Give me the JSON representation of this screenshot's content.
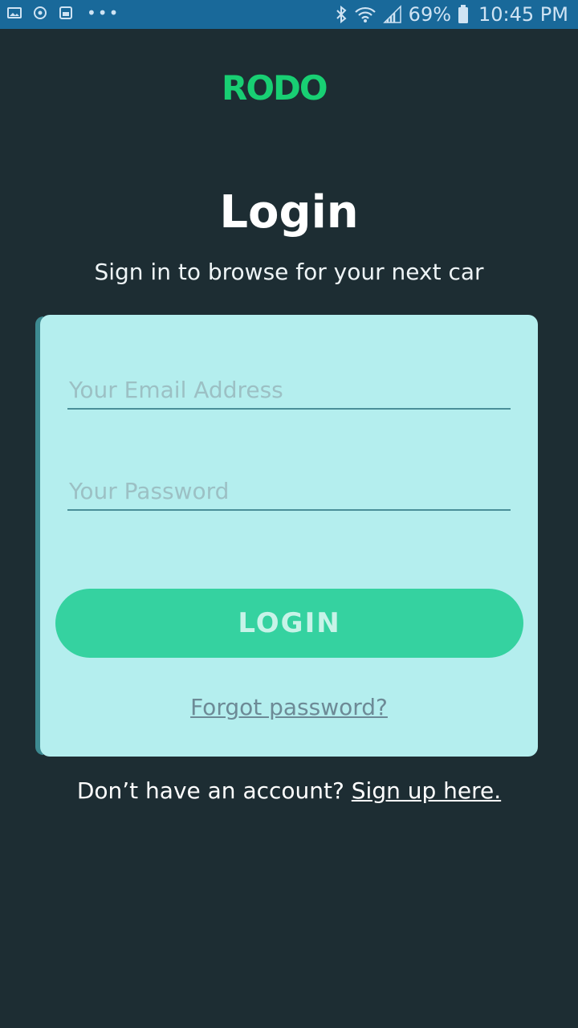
{
  "status_bar": {
    "battery_percent": "69%",
    "time": "10:45 PM",
    "overflow": "•••",
    "icons": [
      "image-icon",
      "sync-icon",
      "screenshot-icon",
      "bluetooth-icon",
      "wifi-icon",
      "signal-icon",
      "battery-icon"
    ]
  },
  "brand": {
    "logo_text": "RODO",
    "logo_color": "#18cf73"
  },
  "header": {
    "title": "Login",
    "subtitle": "Sign in to browse for your next car"
  },
  "form": {
    "email_placeholder": "Your Email Address",
    "password_placeholder": "Your Password",
    "login_label": "LOGIN",
    "forgot_label": "Forgot password?"
  },
  "footer": {
    "prompt": "Don’t have an account?",
    "signup_label": "Sign up here."
  },
  "colors": {
    "background": "#1d2d33",
    "card": "#b4eeee",
    "accent": "#35d2a0",
    "status_bar": "#19699a"
  }
}
